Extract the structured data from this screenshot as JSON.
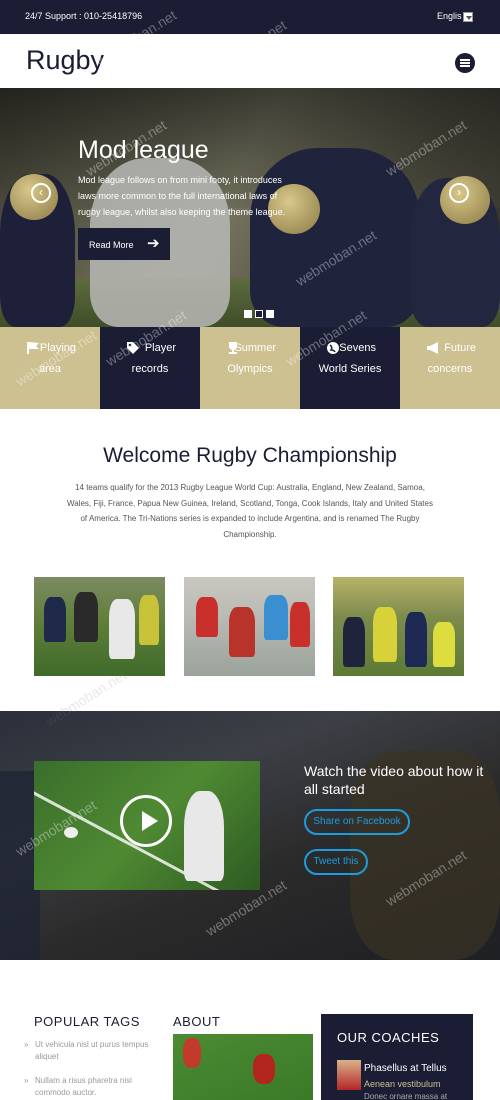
{
  "topbar": {
    "support_text": "24/7 Support : 010-25418796",
    "language": "Englis"
  },
  "header": {
    "logo": "Rugby",
    "menu_icon": "menu-icon"
  },
  "hero": {
    "title": "Mod league",
    "text": "Mod league follows on from mini footy, it introduces laws more common to the full international laws of rugby league, whilst also keeping the theme league.",
    "button_label": "Read More",
    "button_icon": "arrow-right-icon",
    "prev_icon": "chevron-left-icon",
    "next_icon": "chevron-right-icon",
    "slides_total": 3,
    "active_slide": 2
  },
  "features": [
    {
      "line1": "Playing",
      "line2": "area",
      "icon": "flag-icon",
      "style": "light"
    },
    {
      "line1": "Player",
      "line2": "records",
      "icon": "tag-icon",
      "style": "dark"
    },
    {
      "line1": "Summer",
      "line2": "Olympics",
      "icon": "trophy-icon",
      "style": "light"
    },
    {
      "line1": "Sevens",
      "line2": "World Series",
      "icon": "globe-icon",
      "style": "dark"
    },
    {
      "line1": "Future",
      "line2": "concerns",
      "icon": "megaphone-icon",
      "style": "light"
    }
  ],
  "welcome": {
    "title": "Welcome Rugby Championship",
    "text": "14 teams qualify for the 2013 Rugby League World Cup: Australia, England, New Zealand, Samoa, Wales, Fiji, France, Papua New Guinea, Ireland, Scotland, Tonga, Cook Islands, Italy and United States of America. The Tri-Nations series is expanded to include Argentina, and is renamed The Rugby Championship."
  },
  "video": {
    "title": "Watch the video about how it all started",
    "share_facebook": "Share on Facebook",
    "tweet": "Tweet this"
  },
  "popular_tags": {
    "title": "POPULAR TAGS",
    "items": [
      "Ut vehicula nisl ut purus tempus aliquet",
      "Nullam a risus pharetra nisi commodo auctor."
    ]
  },
  "about": {
    "title": "ABOUT"
  },
  "coaches": {
    "title": "OUR COACHES",
    "name": "Phasellus at Tellus",
    "role": "Aenean vestibulum",
    "desc": "Donec ornare massa at"
  },
  "watermark": "webmoban.net",
  "colors": {
    "navy": "#1a1d33",
    "tan": "#cdc192",
    "accent_blue": "#1e9ce0"
  }
}
